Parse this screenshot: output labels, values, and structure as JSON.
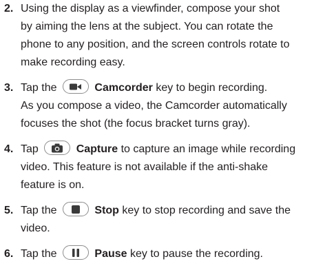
{
  "steps": [
    {
      "number": "2.",
      "lines": [
        "Using the display as a viewfinder, compose your shot",
        "by aiming the lens at the subject. You can rotate the",
        "phone to any position, and the screen controls rotate to",
        "make recording easy."
      ]
    },
    {
      "number": "3.",
      "pre": "Tap the",
      "bold": "Camcorder",
      "post": "key to begin recording.",
      "icon": "camcorder-icon",
      "lines": [
        "As you compose a video, the Camcorder automatically",
        "focuses the shot (the focus bracket turns gray)."
      ]
    },
    {
      "number": "4.",
      "pre": "Tap",
      "bold": "Capture",
      "post": "to capture an image while recording",
      "icon": "camera-icon",
      "lines": [
        "video. This feature is not available if the anti-shake",
        "feature is on."
      ]
    },
    {
      "number": "5.",
      "pre": "Tap the",
      "bold": "Stop",
      "post": "key to stop recording and save the",
      "icon": "stop-icon",
      "lines": [
        "video."
      ]
    },
    {
      "number": "6.",
      "pre": "Tap the",
      "bold": "Pause",
      "post": "key to pause the recording.",
      "icon": "pause-icon"
    }
  ]
}
